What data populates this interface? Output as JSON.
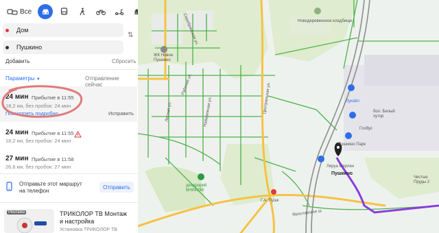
{
  "modes": {
    "all_label": "Все",
    "items": [
      "car-icon",
      "bus-icon",
      "walk-icon",
      "bike-icon",
      "scooter-icon",
      "taxi-icon"
    ]
  },
  "route_from": "Дом",
  "route_to": "Пушкино",
  "actions": {
    "add": "Добавить",
    "reset": "Сбросить"
  },
  "params": {
    "label": "Параметры",
    "departure": "Отправление сейчас"
  },
  "routes": [
    {
      "time": "24 мин",
      "arrival": "Прибытие в 11:55",
      "distance": "18,2 км, без пробок: 24 мин",
      "more": "Посмотреть подробно",
      "edit": "Исправить"
    },
    {
      "time": "24 мин",
      "arrival": "Прибытие в 11:55",
      "distance": "18,2 км, без пробок: 24 мин"
    },
    {
      "time": "27 мин",
      "arrival": "Прибытие в 11:58",
      "distance": "26,6 км, без пробок: 27 мин"
    }
  ],
  "send": {
    "text_line1": "Отправьте этот маршрут",
    "text_line2": "на телефон",
    "button": "Отправить"
  },
  "ad": {
    "badge": "Реклама",
    "title_line1": "ТРИКОЛОР ТВ Монтаж",
    "title_line2": "и настройка",
    "subtitle": "Установка ТРИКОЛОР ТВ"
  },
  "map_labels": {
    "cemetery": "Новодеревенское кладбище",
    "jk_line1": "ЖК Новое",
    "jk_line2": "Пушкино",
    "lukoil": "Лукойл",
    "farm_line1": "бол. Белый",
    "farm_line2": "хутор",
    "globus": "Глобус",
    "globus_park": "Пушкино Парк",
    "merlin": "Леруа Мерлен",
    "destination": "Пушкино",
    "dendro_line1": "дендрарий",
    "dendro_line2": "ВНИИЛМ",
    "station": "Г.А. Пушк",
    "street_right_line1": "Чистые",
    "street_right_line2": "Пруды 2",
    "street_1": "Серебрянская ул.",
    "street_2": "Рабочая ул.",
    "street_3": "Лесная ул.",
    "street_4": "Набережная ул.",
    "street_5": "Центральная ул.",
    "street_6": "Ярославское ш."
  },
  "colors": {
    "accent": "#2d6ee8",
    "road_yellow": "#f5c242",
    "road_green": "#4bb24b",
    "route": "#8a3ce0"
  }
}
